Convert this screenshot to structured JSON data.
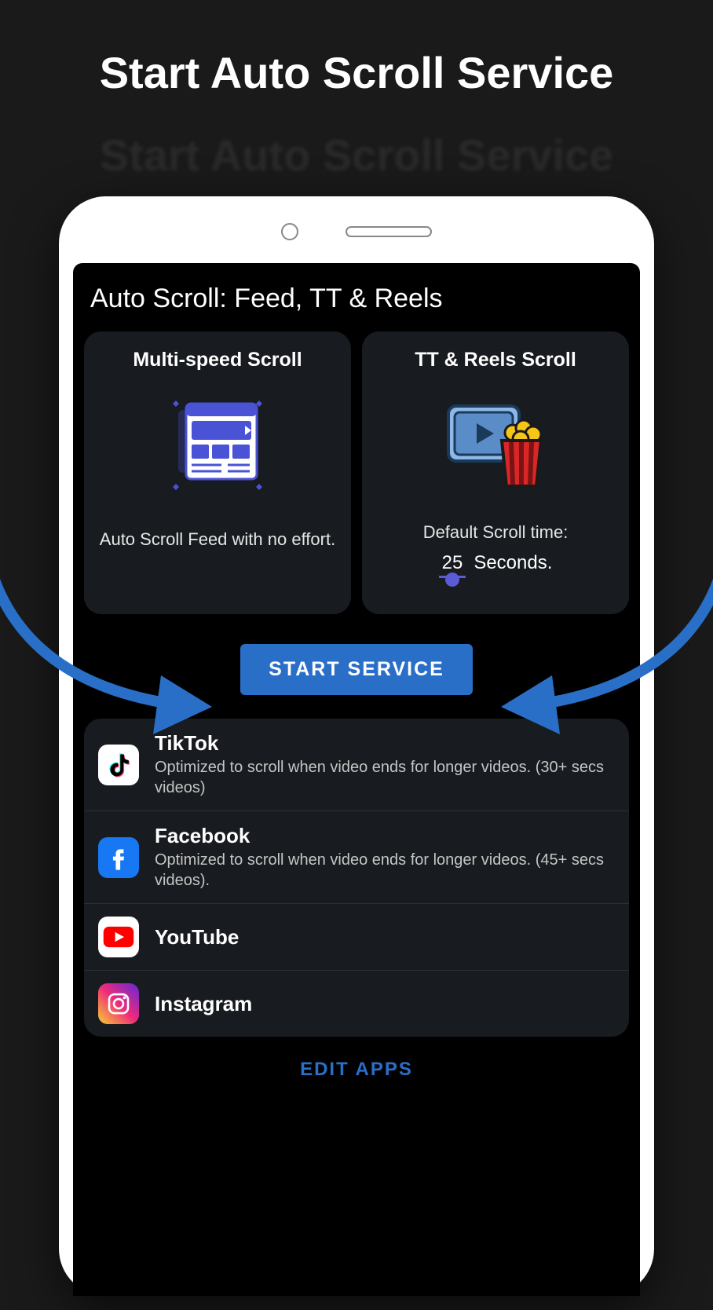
{
  "promo": {
    "title": "Start Auto Scroll Service"
  },
  "app": {
    "title": "Auto Scroll: Feed, TT & Reels"
  },
  "cards": {
    "multi": {
      "title": "Multi-speed Scroll",
      "desc": "Auto Scroll Feed with no effort."
    },
    "reels": {
      "title": "TT & Reels Scroll",
      "time_label": "Default Scroll time:",
      "time_value": "25",
      "time_unit": "Seconds."
    }
  },
  "start_button": "START SERVICE",
  "apps": [
    {
      "name": "TikTok",
      "desc": "Optimized to scroll when video ends for longer videos. (30+ secs videos)"
    },
    {
      "name": "Facebook",
      "desc": "Optimized to scroll when video ends for longer videos. (45+ secs videos)."
    },
    {
      "name": "YouTube",
      "desc": ""
    },
    {
      "name": "Instagram",
      "desc": ""
    }
  ],
  "edit_apps": "EDIT APPS"
}
